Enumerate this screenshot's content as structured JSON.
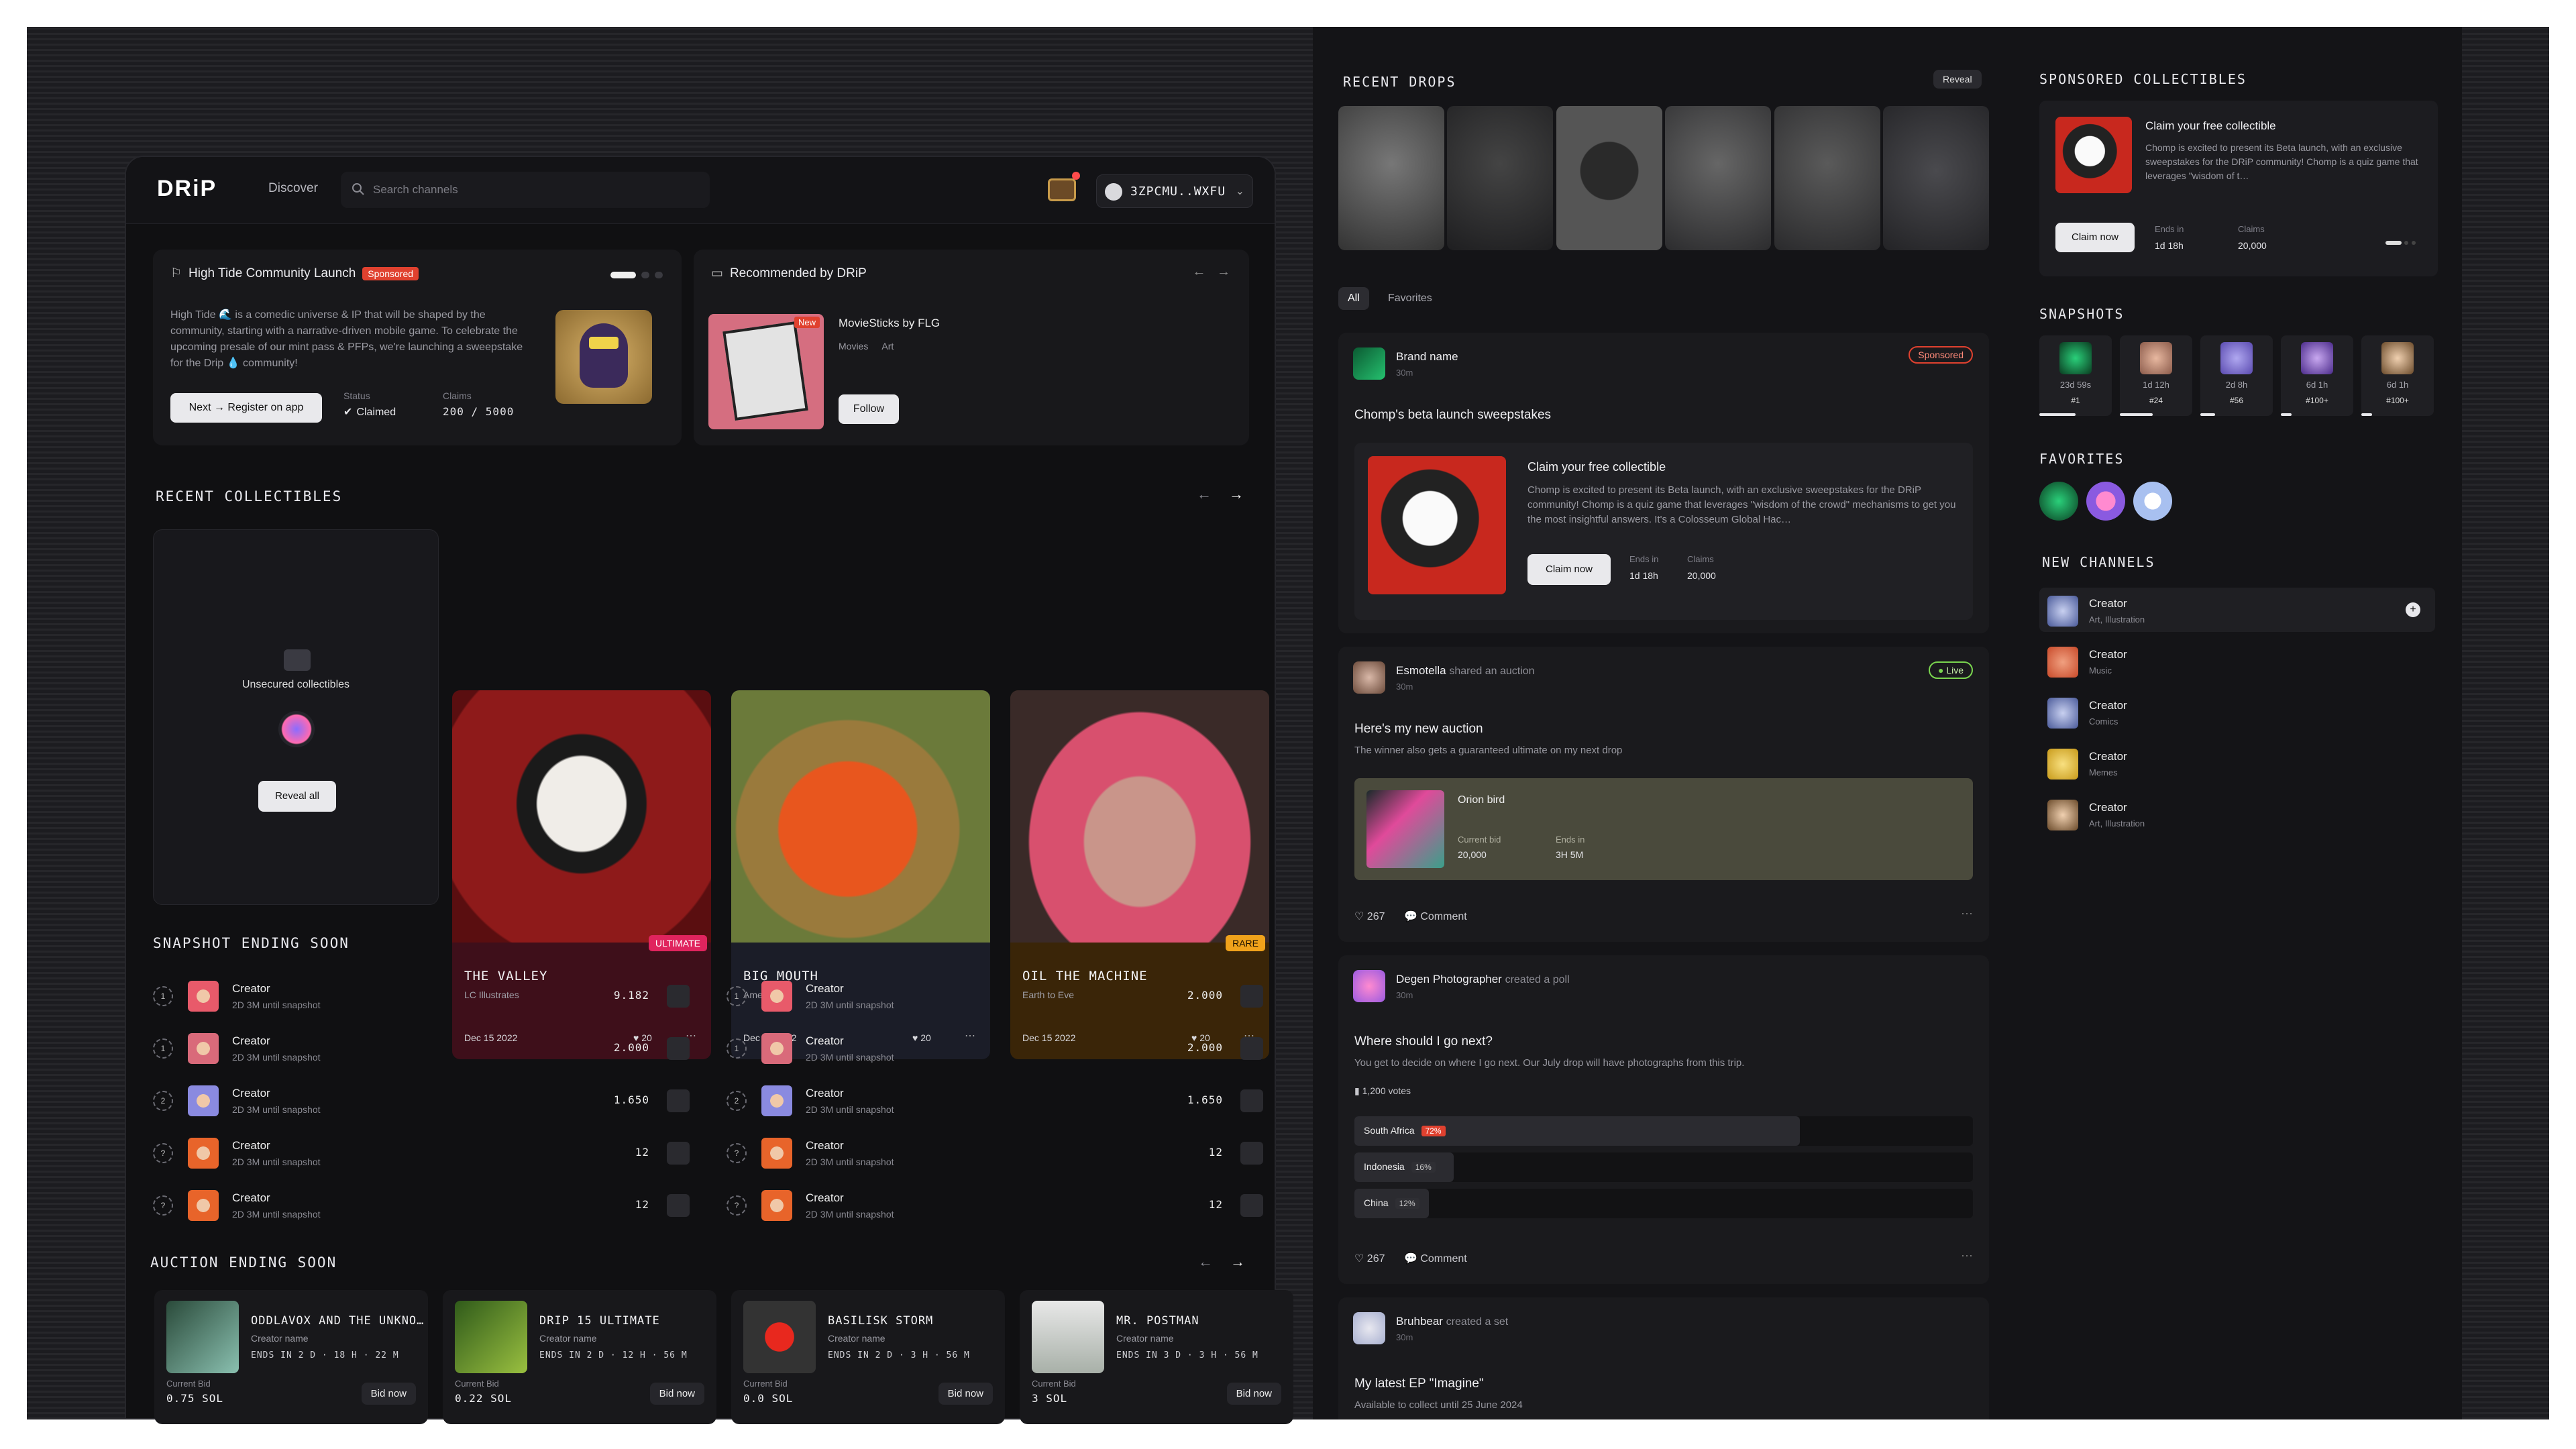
{
  "header": {
    "logo": "DRiP",
    "nav_discover": "Discover",
    "search_placeholder": "Search channels",
    "wallet": "3ZPCMU..WXFU"
  },
  "promo": {
    "title": "High Tide Community Launch",
    "badge": "Sponsored",
    "body": "High Tide 🌊 is a comedic universe & IP that will be shaped by the community, starting with a narrative-driven mobile game. To celebrate the upcoming presale of our mint pass & PFPs, we're launching a sweepstake for the Drip 💧 community!",
    "cta": "Next → Register on app",
    "status_label": "Status",
    "status_value": "Claimed",
    "claims_label": "Claims",
    "claims_value": "200 / 5000"
  },
  "recommended": {
    "title": "Recommended by DRiP",
    "name": "MovieSticks by FLG",
    "tags": [
      "Movies",
      "Art"
    ],
    "new_badge": "New",
    "follow": "Follow"
  },
  "recent_collectibles": {
    "title": "RECENT COLLECTIBLES",
    "unsecured_label": "Unsecured collectibles",
    "reveal_all": "Reveal all",
    "items": [
      {
        "name": "THE VALLEY",
        "creator": "LC Illustrates",
        "date": "Dec 15 2022",
        "likes": "20",
        "tier": "ULTIMATE",
        "tier_color": "#e0245e"
      },
      {
        "name": "BIG MOUTH",
        "creator": "Amet",
        "date": "Dec 15 2022",
        "likes": "20",
        "tier": "",
        "tier_color": ""
      },
      {
        "name": "OIL THE MACHINE",
        "creator": "Earth to Eve",
        "date": "Dec 15 2022",
        "likes": "20",
        "tier": "RARE",
        "tier_color": "#f0a21b"
      }
    ]
  },
  "snapshot_ending": {
    "title": "SNAPSHOT ENDING SOON",
    "left": [
      {
        "rank": "1",
        "name": "Creator",
        "sub": "2D 3M until snapshot",
        "amount": "9.182"
      },
      {
        "rank": "1",
        "name": "Creator",
        "sub": "2D 3M until snapshot",
        "amount": "2.000"
      },
      {
        "rank": "2",
        "name": "Creator",
        "sub": "2D 3M until snapshot",
        "amount": "1.650"
      },
      {
        "rank": "?",
        "name": "Creator",
        "sub": "2D 3M until snapshot",
        "amount": "12"
      },
      {
        "rank": "?",
        "name": "Creator",
        "sub": "2D 3M until snapshot",
        "amount": "12"
      }
    ],
    "right": [
      {
        "rank": "1",
        "name": "Creator",
        "sub": "2D 3M until snapshot",
        "amount": "2.000"
      },
      {
        "rank": "1",
        "name": "Creator",
        "sub": "2D 3M until snapshot",
        "amount": "2.000"
      },
      {
        "rank": "2",
        "name": "Creator",
        "sub": "2D 3M until snapshot",
        "amount": "1.650"
      },
      {
        "rank": "?",
        "name": "Creator",
        "sub": "2D 3M until snapshot",
        "amount": "12"
      },
      {
        "rank": "?",
        "name": "Creator",
        "sub": "2D 3M until snapshot",
        "amount": "12"
      }
    ]
  },
  "auction_ending": {
    "title": "AUCTION ENDING SOON",
    "items": [
      {
        "title": "ODDLAVOX AND THE UNKNO…",
        "creator": "Creator name",
        "ends": "ENDS IN 2 D · 18 H · 22 M",
        "bid_label": "Current Bid",
        "bid": "0.75 SOL",
        "cta": "Bid now"
      },
      {
        "title": "DRIP 15 ULTIMATE",
        "creator": "Creator name",
        "ends": "ENDS IN 2 D · 12 H · 56 M",
        "bid_label": "Current Bid",
        "bid": "0.22 SOL",
        "cta": "Bid now"
      },
      {
        "title": "BASILISK STORM",
        "creator": "Creator name",
        "ends": "ENDS IN 2 D · 3 H · 56 M",
        "bid_label": "Current Bid",
        "bid": "0.0 SOL",
        "cta": "Bid now"
      },
      {
        "title": "MR. POSTMAN",
        "creator": "Creator name",
        "ends": "ENDS IN 3 D · 3 H · 56 M",
        "bid_label": "Current Bid",
        "bid": "3 SOL",
        "cta": "Bid now"
      }
    ]
  },
  "recent_drops": {
    "title": "RECENT DROPS",
    "reveal": "Reveal"
  },
  "feed_tabs": [
    "All",
    "Favorites"
  ],
  "feed": {
    "post1": {
      "author": "Brand name",
      "time": "30m",
      "badge": "Sponsored",
      "headline": "Chomp's beta launch sweepstakes",
      "inner_title": "Claim your free collectible",
      "inner_body": "Chomp is excited to present its Beta launch, with an exclusive sweepstakes for the DRiP community! Chomp is a quiz game that leverages \"wisdom of the crowd\" mechanisms to get you the most insightful answers. It's a Colosseum Global Hac…",
      "cta": "Claim now",
      "ends_label": "Ends in",
      "ends": "1d 18h",
      "claims_label": "Claims",
      "claims": "20,000"
    },
    "post2": {
      "author": "Esmotella",
      "action": "shared an auction",
      "time": "30m",
      "badge": "Live",
      "headline": "Here's my new auction",
      "desc": "The winner also gets a guaranteed ultimate on my next drop",
      "auction_name": "Orion bird",
      "bid_label": "Current bid",
      "bid": "20,000",
      "ends_label": "Ends in",
      "ends": "3H 5M",
      "likes": "267",
      "comment": "Comment"
    },
    "post3": {
      "author": "Degen Photographer",
      "action": "created a poll",
      "time": "30m",
      "headline": "Where should I go next?",
      "desc": "You get to decide on where I go next. Our July drop will have photographs from this trip.",
      "votes": "1,200 votes",
      "options": [
        {
          "label": "South Africa",
          "pct": "72%",
          "value": 72
        },
        {
          "label": "Indonesia",
          "pct": "16%",
          "value": 16
        },
        {
          "label": "China",
          "pct": "12%",
          "value": 12
        }
      ],
      "likes": "267",
      "comment": "Comment"
    },
    "post4": {
      "author": "Bruhbear",
      "action": "created a set",
      "time": "30m",
      "headline": "My latest EP \"Imagine\"",
      "desc": "Available to collect until 25 June 2024"
    }
  },
  "sponsored_collectibles": {
    "title": "SPONSORED COLLECTIBLES",
    "card_title": "Claim your free collectible",
    "card_body": "Chomp is excited to present its Beta launch, with an exclusive sweepstakes for the DRiP community! Chomp is a quiz game that leverages \"wisdom of t…",
    "cta": "Claim now",
    "ends_label": "Ends in",
    "ends": "1d 18h",
    "claims_label": "Claims",
    "claims": "20,000"
  },
  "snapshots": {
    "title": "SNAPSHOTS",
    "items": [
      {
        "time": "23d 59s",
        "rank": "#1",
        "progress": 0.5
      },
      {
        "time": "1d 12h",
        "rank": "#24",
        "progress": 0.45
      },
      {
        "time": "2d 8h",
        "rank": "#56",
        "progress": 0.2
      },
      {
        "time": "6d 1h",
        "rank": "#100+",
        "progress": 0.15
      },
      {
        "time": "6d 1h",
        "rank": "#100+",
        "progress": 0.15
      }
    ]
  },
  "favorites": {
    "title": "FAVORITES"
  },
  "new_channels": {
    "title": "NEW CHANNELS",
    "items": [
      {
        "name": "Creator",
        "tags": "Art, Illustration"
      },
      {
        "name": "Creator",
        "tags": "Music"
      },
      {
        "name": "Creator",
        "tags": "Comics"
      },
      {
        "name": "Creator",
        "tags": "Memes"
      },
      {
        "name": "Creator",
        "tags": "Art, Illustration"
      }
    ]
  }
}
